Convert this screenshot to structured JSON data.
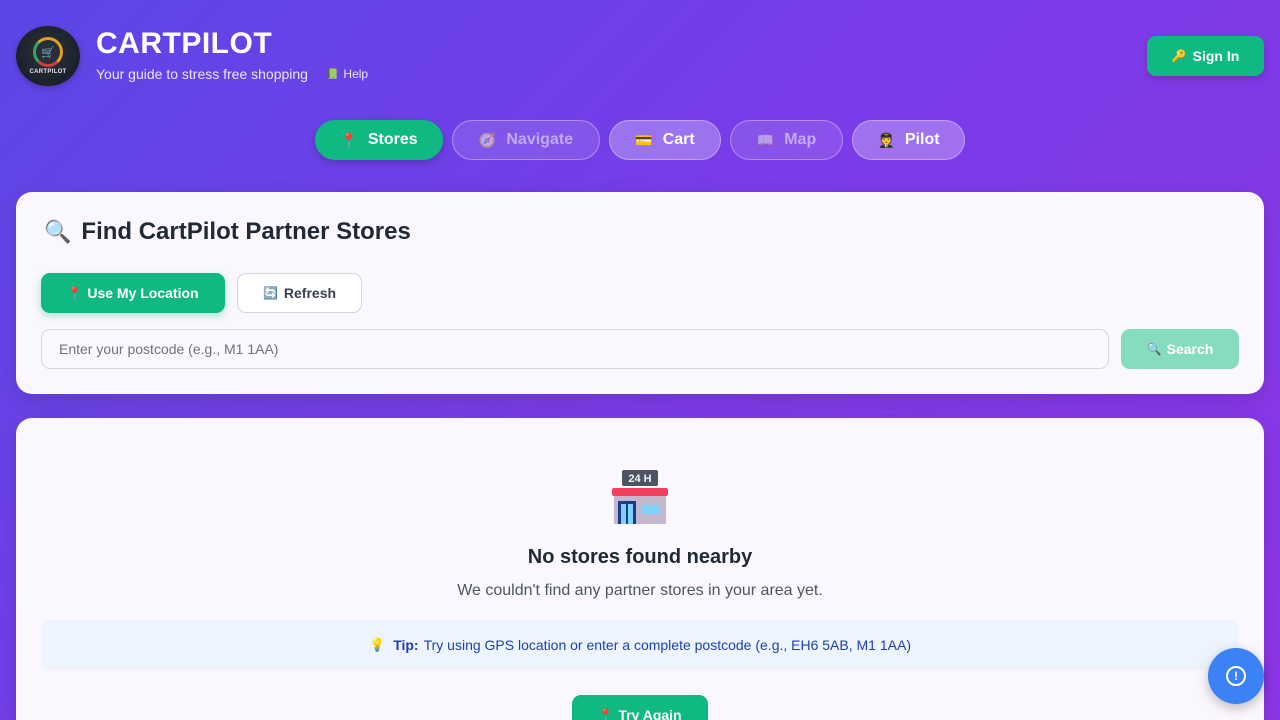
{
  "header": {
    "logo_text": "CARTPILOT",
    "title": "CARTPILOT",
    "tagline": "Your guide to stress free shopping",
    "help_label": "Help",
    "help_icon": "book-icon"
  },
  "auth": {
    "sign_in_label": "Sign In",
    "sign_in_icon": "key-icon"
  },
  "nav": {
    "tabs": [
      {
        "label": "Stores",
        "icon": "pin-icon",
        "state": "active"
      },
      {
        "label": "Navigate",
        "icon": "compass-icon",
        "state": "disabled"
      },
      {
        "label": "Cart",
        "icon": "card-icon",
        "state": "normal"
      },
      {
        "label": "Map",
        "icon": "map-icon",
        "state": "disabled"
      },
      {
        "label": "Pilot",
        "icon": "pilot-icon",
        "state": "normal"
      }
    ]
  },
  "search": {
    "title": "Find CartPilot Partner Stores",
    "use_location_label": "Use My Location",
    "refresh_label": "Refresh",
    "postcode_placeholder": "Enter your postcode (e.g., M1 1AA)",
    "postcode_value": "",
    "search_label": "Search"
  },
  "results": {
    "store_sign": "24 H",
    "empty_title": "No stores found nearby",
    "empty_desc": "We couldn't find any partner stores in your area yet.",
    "tip_label": "Tip:",
    "tip_text": "Try using GPS location or enter a complete postcode (e.g., EH6 5AB, M1 1AA)",
    "retry_label": "Try Again"
  },
  "colors": {
    "accent": "#10b981",
    "background_start": "#5b47e6",
    "background_end": "#8d36e6",
    "fab": "#3b82f6"
  }
}
